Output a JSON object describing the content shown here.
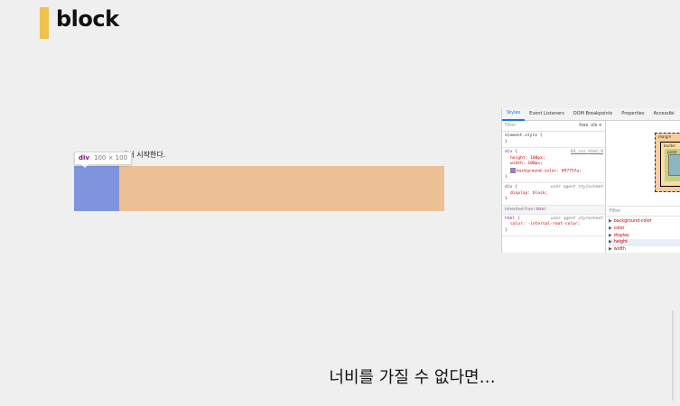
{
  "slide": {
    "title": "block",
    "accent_color": "#f0c14b",
    "subtitle": "너비를 가질 수 없다면…"
  },
  "inspector_tooltip": {
    "tag": "div",
    "size": "100 × 100"
  },
  "page_content": {
    "caption": "에서 시작한다.",
    "div_color": "#7e94dd",
    "margin_highlight_color": "#ecc094"
  },
  "devtools": {
    "tabs": [
      "Styles",
      "Event Listeners",
      "DOM Breakpoints",
      "Properties",
      "Accessibi"
    ],
    "active_tab": "Styles",
    "filter_placeholder": "Filter",
    "hov_cls": ":hov  .cls  +",
    "rules": [
      {
        "selector": "element.style {",
        "source": "",
        "props": [],
        "close": "}"
      },
      {
        "selector": "div {",
        "source": "03_css.html:9",
        "props": [
          "height: 100px;",
          "width: 100px;",
          "background-color: #9775fa;"
        ],
        "close": "}"
      },
      {
        "selector": "div {",
        "source": "user agent stylesheet",
        "props": [
          "display: block;"
        ],
        "close": "}"
      }
    ],
    "inherited_label": "Inherited from",
    "inherited_tag": "html",
    "inherited_rule": {
      "selector": "html {",
      "source": "user agent stylesheet",
      "props": [
        "color: -internal-root-color;"
      ],
      "close": "}"
    },
    "box_model": {
      "margin_label": "margin",
      "border_label": "border",
      "padding_label": "padd"
    },
    "computed_filter": "Filter",
    "computed_props": [
      "background-color",
      "color",
      "display",
      "height",
      "width"
    ],
    "swatch_color": "#9775fa"
  }
}
